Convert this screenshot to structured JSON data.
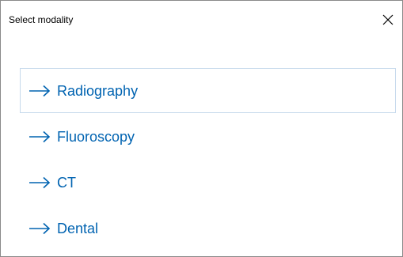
{
  "dialog": {
    "title": "Select modality",
    "close_icon": "close-icon"
  },
  "options": [
    {
      "label": "Radiography",
      "icon": "arrow-right-icon",
      "selected": true
    },
    {
      "label": "Fluoroscopy",
      "icon": "arrow-right-icon",
      "selected": false
    },
    {
      "label": "CT",
      "icon": "arrow-right-icon",
      "selected": false
    },
    {
      "label": "Dental",
      "icon": "arrow-right-icon",
      "selected": false
    }
  ],
  "colors": {
    "link": "#0063b1",
    "selected_border": "#c6d9ec",
    "window_border": "#8a8a8a"
  }
}
